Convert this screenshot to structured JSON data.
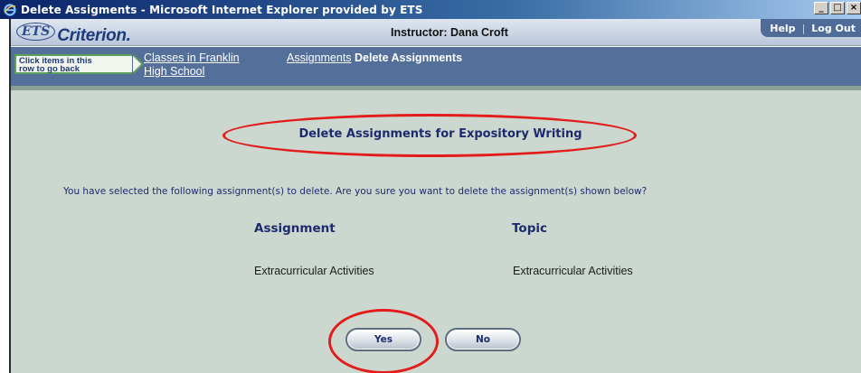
{
  "window": {
    "title": "Delete Assigments - Microsoft Internet Explorer provided by ETS",
    "controls": [
      "_",
      "□",
      "×"
    ]
  },
  "header": {
    "logo_badge": "ETS",
    "brand": "Criterion.",
    "instructor": "Instructor: Dana Croft",
    "links": {
      "help": "Help",
      "separator": "|",
      "logout": "Log Out"
    }
  },
  "breadcrumbs": {
    "hint": "Click items in this row to go back",
    "hint_line1": "Click items in this",
    "hint_line2": "row to go back",
    "classes_line1": "Classes in Franklin",
    "classes_line2": "High School",
    "assignments": "Assignments",
    "current": "Delete Assignments"
  },
  "main": {
    "title": "Delete Assignments for Expository Writing",
    "question": "You have selected the following assignment(s) to delete. Are you sure you want to delete the assignment(s) shown below?",
    "columns": {
      "assignment": "Assignment",
      "topic": "Topic"
    },
    "rows": [
      {
        "assignment": "Extracurricular Activities",
        "topic": "Extracurricular Activities"
      }
    ],
    "buttons": {
      "yes": "Yes",
      "no": "No"
    }
  },
  "colors": {
    "highlight_oval": "#e21b1b",
    "content_bg": "#ccd8cf",
    "breadcrumb_bg": "#536f9a",
    "title_text": "#1d2a6e"
  },
  "icons": {
    "window": "internet-explorer-icon",
    "minimize": "minimize-icon",
    "maximize": "maximize-icon",
    "close": "close-icon"
  }
}
